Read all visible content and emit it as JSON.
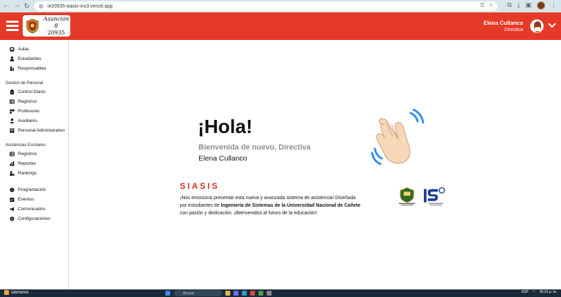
{
  "browser": {
    "url": "ie20935-siasis-ins3.vercel.app"
  },
  "header": {
    "logo_line1": "Asunción 8",
    "logo_line2": "20935",
    "user_name": "Elena Cullanco",
    "user_role": "Directiva"
  },
  "sidebar": {
    "top_items": [
      {
        "label": "Aulas",
        "icon": "classroom-icon"
      },
      {
        "label": "Estudiantes",
        "icon": "student-icon"
      },
      {
        "label": "Responsables",
        "icon": "guardian-icon"
      }
    ],
    "section1_title": "Gestion de Personal",
    "section1_items": [
      {
        "label": "Control Diario",
        "icon": "clipboard-icon"
      },
      {
        "label": "Registros",
        "icon": "table-icon"
      },
      {
        "label": "Profesores",
        "icon": "teacher-icon"
      },
      {
        "label": "Auxiliares",
        "icon": "assistant-icon"
      },
      {
        "label": "Personal Administrativo",
        "icon": "staff-icon"
      }
    ],
    "section2_title": "Asistencias Escolares",
    "section2_items": [
      {
        "label": "Registros",
        "icon": "table-icon"
      },
      {
        "label": "Reportes",
        "icon": "report-icon"
      },
      {
        "label": "Rankings",
        "icon": "ranking-icon"
      }
    ],
    "bottom_items": [
      {
        "label": "Programación",
        "icon": "clock-icon"
      },
      {
        "label": "Eventos",
        "icon": "calendar-check-icon"
      },
      {
        "label": "Comunicados",
        "icon": "megaphone-icon"
      },
      {
        "label": "Configuraciones",
        "icon": "gear-icon"
      }
    ]
  },
  "main": {
    "greeting": "¡Hola!",
    "welcome": "Bienvenida de nuevo, Directiva",
    "welcome_name": "Elena Cullanco",
    "brand": "SIASIS",
    "desc_part1": "¡Nos emociona presentar esta nueva y avanzada sistema de asistencia! Diseñada por estudiantes de ",
    "desc_bold": "Ingeniería de Sistemas de la Universidad Nacional de Cañete",
    "desc_part2": " con pasión y dedicación. ¡Bienvenidos al futuro de la educación!"
  },
  "taskbar": {
    "weather": "GBP/MXN",
    "search_placeholder": "Buscar",
    "lang": "ESP",
    "time": "06:32 p. m."
  },
  "colors": {
    "header": "#e53a27",
    "brand_red": "#d62d20"
  }
}
